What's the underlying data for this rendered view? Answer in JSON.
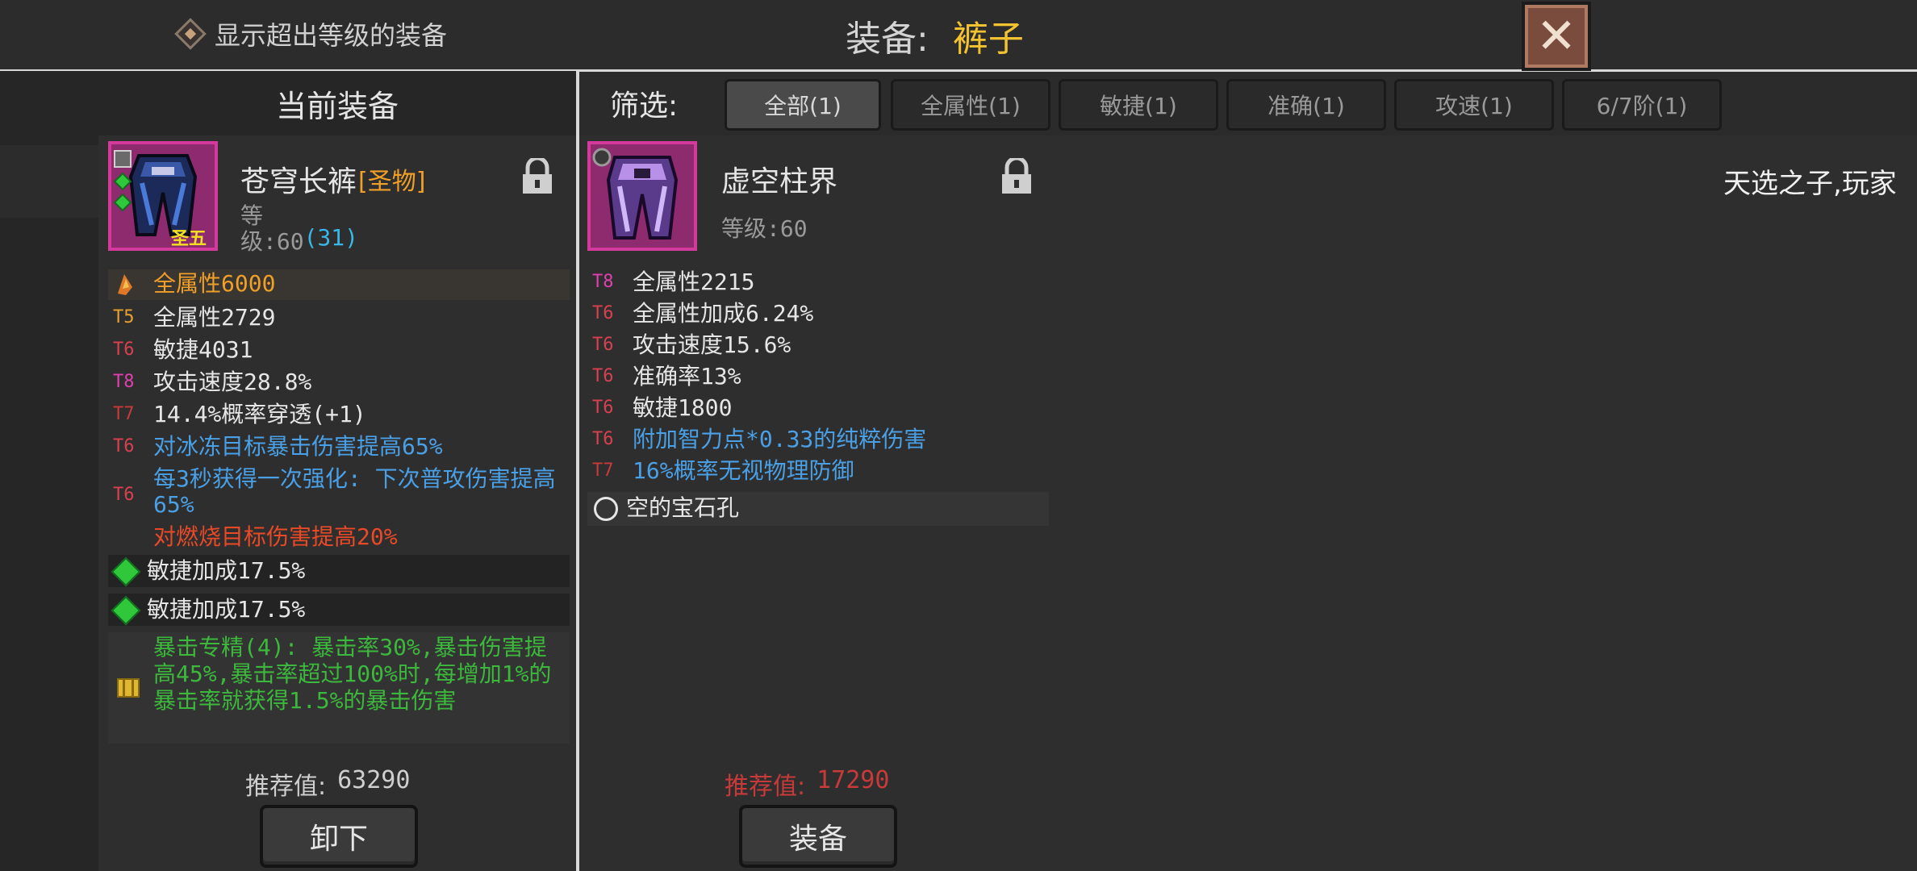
{
  "header": {
    "toggle_label": "显示超出等级的装备",
    "title_label": "装备:",
    "title_value": "裤子"
  },
  "current": {
    "header": "当前装备",
    "item_name": "苍穹长裤",
    "item_tag": "[圣物]",
    "badge": "圣五",
    "level_prefix": "等",
    "level_label": "级:60",
    "level_extra": "(31)",
    "main_stat": "全属性6000",
    "stats": [
      {
        "tier": "T5",
        "text": "全属性2729"
      },
      {
        "tier": "T6",
        "text": "敏捷4031"
      },
      {
        "tier": "T8",
        "text": "攻击速度28.8%"
      },
      {
        "tier": "T7",
        "text": "14.4%概率穿透(+1)"
      },
      {
        "tier": "T6",
        "text": "对冰冻目标暴击伤害提高65%"
      },
      {
        "tier": "T6",
        "text": "每3秒获得一次强化: 下次普攻伤害提高65%"
      }
    ],
    "bonus_red": "对燃烧目标伤害提高20%",
    "gems": [
      "敏捷加成17.5%",
      "敏捷加成17.5%"
    ],
    "set_text": "暴击专精(4): 暴击率30%,暴击伤害提高45%,暴击率超过100%时,每增加1%的暴击率就获得1.5%的暴击伤害",
    "score_label": "推荐值:",
    "score_value": "63290",
    "button": "卸下"
  },
  "filter": {
    "label": "筛选:",
    "tabs": [
      "全部(1)",
      "全属性(1)",
      "敏捷(1)",
      "准确(1)",
      "攻速(1)",
      "6/7阶(1)"
    ]
  },
  "candidate": {
    "item_name": "虚空柱界",
    "level_label": "等级:60",
    "stats": [
      {
        "tier": "T8",
        "text": "全属性2215",
        "color": "white"
      },
      {
        "tier": "T6",
        "text": "全属性加成6.24%",
        "color": "white"
      },
      {
        "tier": "T6",
        "text": "攻击速度15.6%",
        "color": "white"
      },
      {
        "tier": "T6",
        "text": "准确率13%",
        "color": "white"
      },
      {
        "tier": "T6",
        "text": "敏捷1800",
        "color": "white"
      },
      {
        "tier": "T6",
        "text": "附加智力点*0.33的纯粹伤害",
        "color": "blue"
      },
      {
        "tier": "T7",
        "text": "16%概率无视物理防御",
        "color": "blue"
      }
    ],
    "socket": "空的宝石孔",
    "score_label": "推荐值:",
    "score_value": "17290",
    "button": "装备"
  },
  "right": {
    "text": "天选之子,玩家"
  },
  "colors": {
    "rare_frame": "#d43a9c",
    "title_accent": "#f2c230",
    "score_red": "#c83a3a"
  }
}
